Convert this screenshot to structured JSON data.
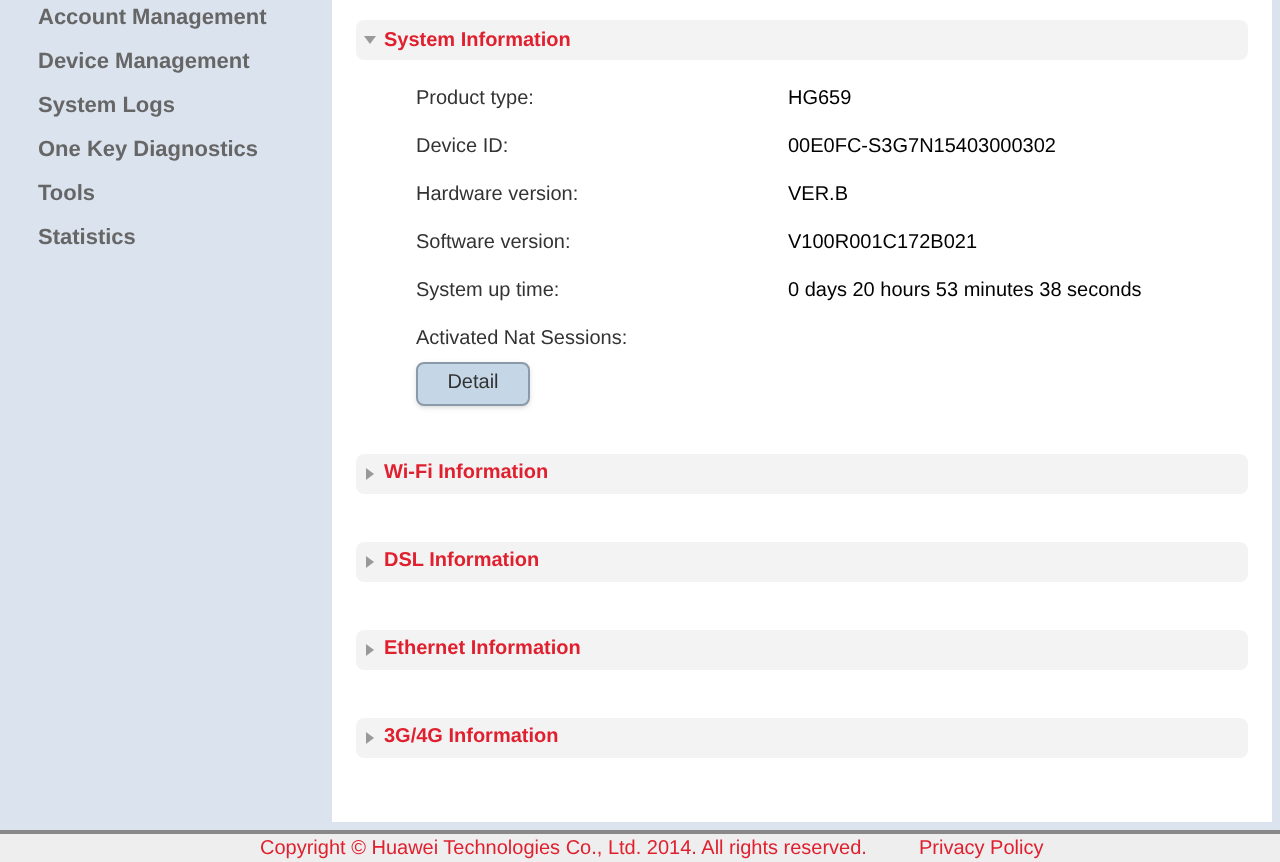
{
  "sidebar": {
    "items": [
      {
        "label": "Account Management",
        "selected": false
      },
      {
        "label": "Device Management",
        "selected": false
      },
      {
        "label": "System Logs",
        "selected": false
      },
      {
        "label": "One Key Diagnostics",
        "selected": false
      },
      {
        "label": "Tools",
        "selected": false
      },
      {
        "label": "Statistics",
        "selected": false
      }
    ]
  },
  "sections": [
    {
      "title": "System Information",
      "expanded": true,
      "rows": [
        {
          "label": "Product type:",
          "value": "HG659"
        },
        {
          "label": "Device ID:",
          "value": "00E0FC-S3G7N15403000302"
        },
        {
          "label": "Hardware version:",
          "value": "VER.B"
        },
        {
          "label": "Software version:",
          "value": "V100R001C172B021"
        },
        {
          "label": "System up time:",
          "value": "0 days 20 hours 53 minutes 38 seconds"
        },
        {
          "label": "Activated Nat Sessions:"
        }
      ],
      "button": "Detail"
    },
    {
      "title": "Wi-Fi Information",
      "expanded": false
    },
    {
      "title": "DSL Information",
      "expanded": false
    },
    {
      "title": "Ethernet Information",
      "expanded": false
    },
    {
      "title": "3G/4G Information",
      "expanded": false
    }
  ],
  "footer": {
    "copyright": "Copyright © Huawei Technologies Co., Ltd. 2014. All rights reserved.",
    "link": "Privacy Policy"
  }
}
